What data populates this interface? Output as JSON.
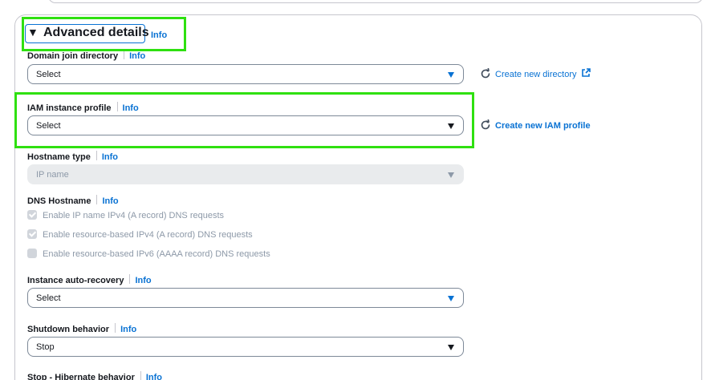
{
  "advanced": {
    "title": "Advanced details",
    "info": "Info",
    "toggle_glyph": "▼"
  },
  "domain_join": {
    "label": "Domain join directory",
    "info": "Info",
    "value": "Select",
    "link": "Create new directory",
    "link_icon": "external-link-icon"
  },
  "iam": {
    "label": "IAM instance profile",
    "info": "Info",
    "value": "Select",
    "link": "Create new IAM profile"
  },
  "hostname_type": {
    "label": "Hostname type",
    "info": "Info",
    "placeholder": "IP name"
  },
  "dns_hostname": {
    "label": "DNS Hostname",
    "info": "Info",
    "options": [
      {
        "label": "Enable IP name IPv4 (A record) DNS requests",
        "checked": true
      },
      {
        "label": "Enable resource-based IPv4 (A record) DNS requests",
        "checked": true
      },
      {
        "label": "Enable resource-based IPv6 (AAAA record) DNS requests",
        "checked": false
      }
    ]
  },
  "auto_recovery": {
    "label": "Instance auto-recovery",
    "info": "Info",
    "value": "Select"
  },
  "shutdown": {
    "label": "Shutdown behavior",
    "info": "Info",
    "value": "Stop"
  },
  "hibernate": {
    "label": "Stop - Hibernate behavior",
    "info": "Info"
  },
  "colors": {
    "link": "#0972d3",
    "highlight": "#2fe010",
    "disabled_text": "#8d99a8"
  }
}
